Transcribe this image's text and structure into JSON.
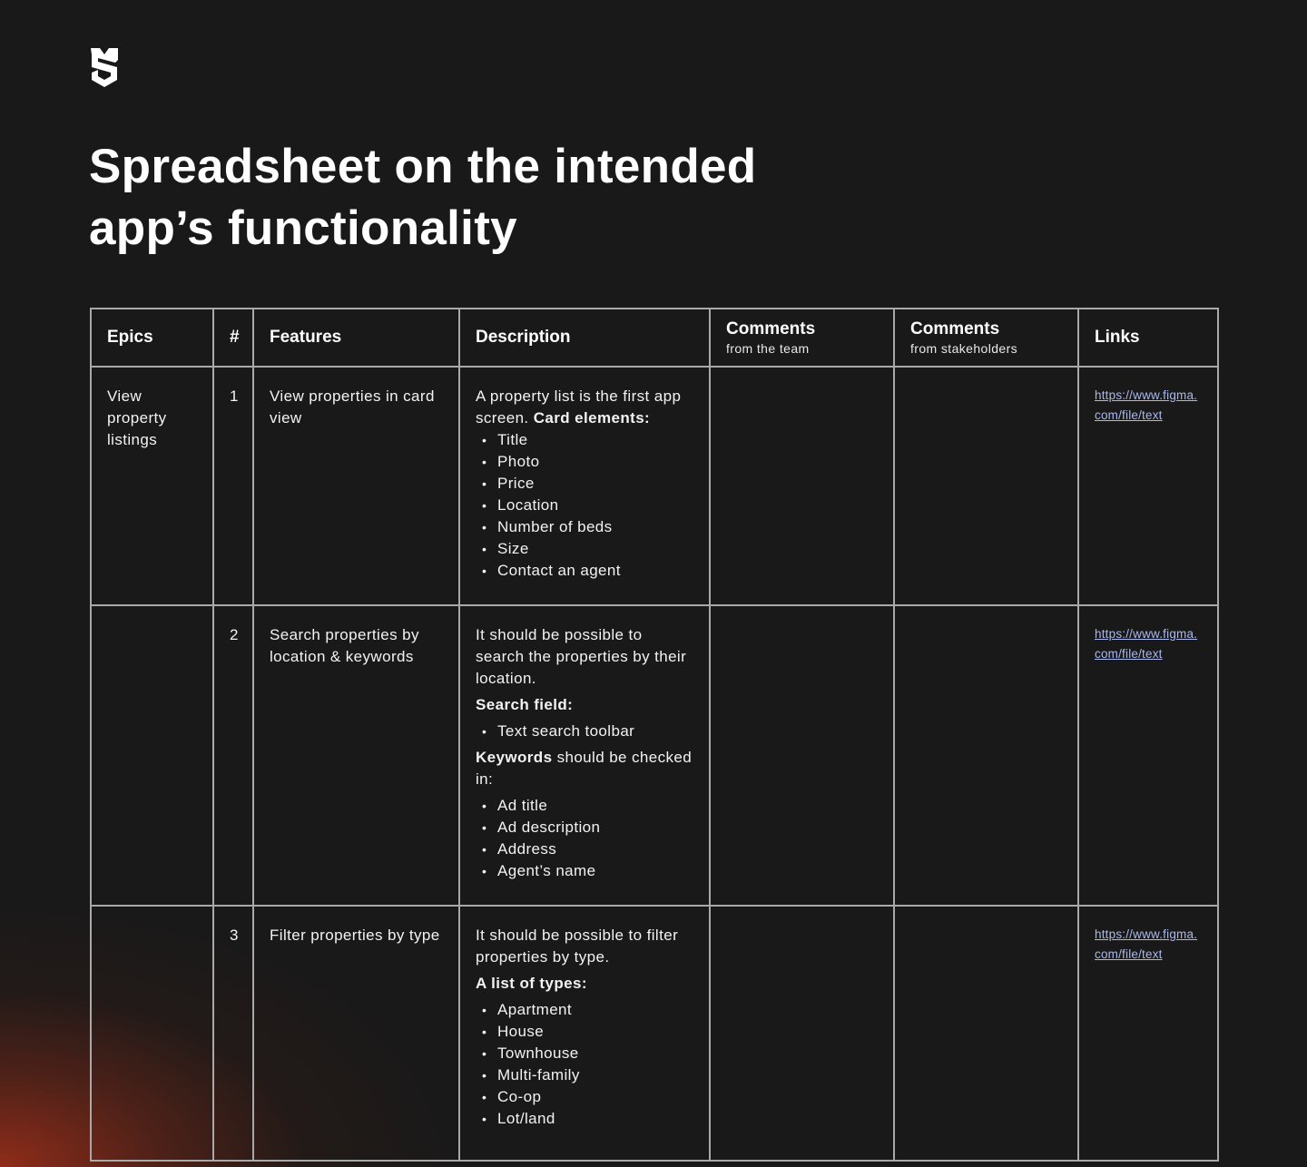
{
  "brand": {
    "logo_icon": "shield-s-logo-icon"
  },
  "title": {
    "line1": "Spreadsheet on the intended",
    "line2": "app’s functionality"
  },
  "table": {
    "headers": {
      "epics": "Epics",
      "number": "#",
      "features": "Features",
      "description": "Description",
      "comments_team": {
        "title": "Comments",
        "sub": "from the team"
      },
      "comments_stakeholders": {
        "title": "Comments",
        "sub": "from stakeholders"
      },
      "links": "Links"
    },
    "rows": [
      {
        "epic": "View property listings",
        "number": "1",
        "feature": "View properties in card view",
        "description": {
          "intro": "A property list is the first app screen.",
          "bold": "Card elements:",
          "items": [
            "Title",
            "Photo",
            "Price",
            "Location",
            "Number of beds",
            "Size",
            "Contact an agent"
          ]
        },
        "comments_team": "",
        "comments_stakeholders": "",
        "link": "https://www.figma.com/file/text"
      },
      {
        "epic": "",
        "number": "2",
        "feature": "Search properties by location & keywords",
        "description": {
          "intro": "It should be possible to search the properties by their location.",
          "search_label": "Search field:",
          "search_items": [
            "Text search toolbar"
          ],
          "keywords_bold": "Keywords",
          "keywords_rest": " should be checked in:",
          "keyword_items": [
            "Ad title",
            "Ad description",
            "Address",
            "Agent’s name"
          ]
        },
        "comments_team": "",
        "comments_stakeholders": "",
        "link": "https://www.figma.com/file/text"
      },
      {
        "epic": "",
        "number": "3",
        "feature": "Filter properties by type",
        "description": {
          "intro": "It should be possible to filter properties by type.",
          "bold": "A list of types:",
          "items": [
            "Apartment",
            "House",
            "Townhouse",
            "Multi-family",
            "Co-op",
            "Lot/land"
          ]
        },
        "comments_team": "",
        "comments_stakeholders": "",
        "link": "https://www.figma.com/file/text"
      }
    ]
  },
  "colors": {
    "background": "#191919",
    "grid_line": "#a9a9a9",
    "link": "#a9b8ee",
    "glow": "#962d19"
  }
}
